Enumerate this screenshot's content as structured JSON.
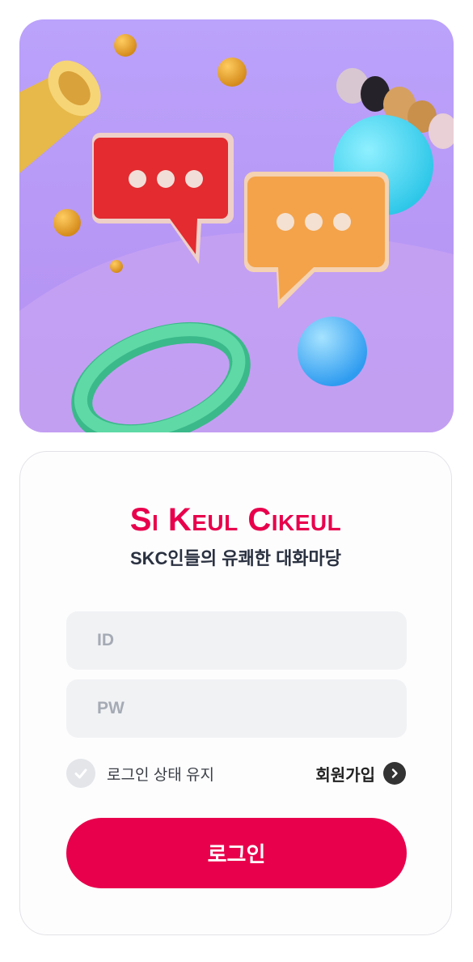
{
  "hero": {
    "image": "chat-bubbles-illustration"
  },
  "brand": {
    "logo": "Si Keul Cikeul",
    "tagline": "SKC인들의 유쾌한 대화마당"
  },
  "form": {
    "id_placeholder": "ID",
    "pw_placeholder": "PW",
    "keep_login_label": "로그인 상태 유지",
    "signup_label": "회원가입",
    "login_button": "로그인"
  },
  "colors": {
    "accent": "#e8004c",
    "field_bg": "#f1f2f4",
    "hero_bg": "#b99cf5"
  },
  "icons": {
    "check": "check-icon",
    "signup_arrow": "chevron-right-icon"
  }
}
